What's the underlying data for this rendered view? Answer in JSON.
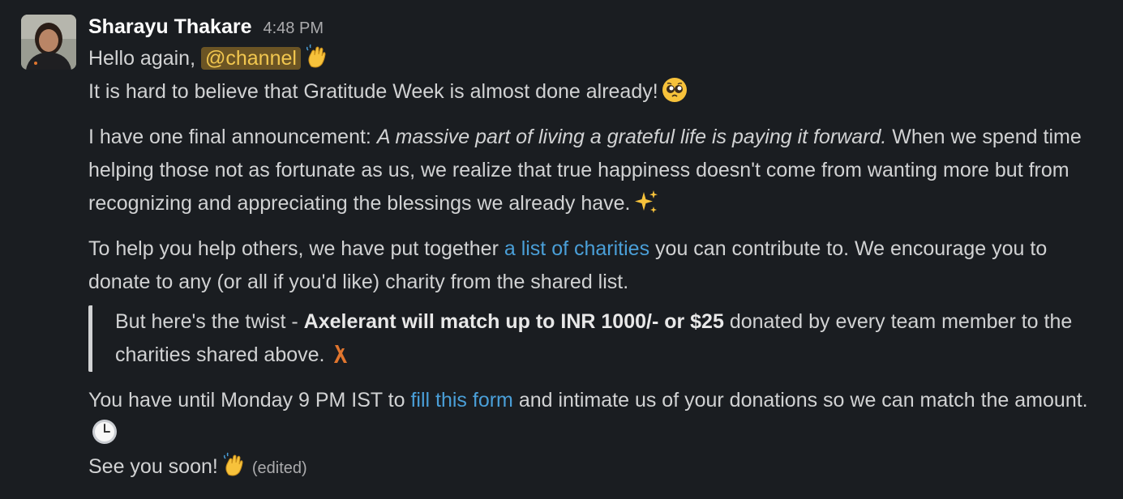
{
  "message": {
    "sender": "Sharayu Thakare",
    "timestamp": "4:48 PM",
    "line1_prefix": "Hello again, ",
    "mention": "@channel",
    "line2": "It is hard to believe that Gratitude Week is almost done already!",
    "para2_prefix": "I have one final announcement: ",
    "para2_italic": "A massive part of living a grateful life is paying it forward.",
    "para2_rest": " When we spend time helping those not as fortunate as us, we realize that true happiness doesn't come from wanting more but from recognizing and appreciating the blessings we already have.",
    "para3_prefix": "To help you help others, we have put together ",
    "para3_link": "a list of charities",
    "para3_rest": " you can contribute to. We encourage you to donate to any (or all if you'd like) charity from the shared list.",
    "quote_prefix": "But here's the twist - ",
    "quote_bold": "Axelerant will match up to INR 1000/- or $25",
    "quote_rest": " donated by every team member to the charities shared above.",
    "para5_prefix": "You have until Monday 9 PM IST to ",
    "para5_link": "fill this form",
    "para5_rest": " and intimate us of your donations so we can match the amount.",
    "closing": "See you soon!",
    "edited": "(edited)"
  },
  "icons": {
    "wave": "waving-hand-icon",
    "pleading": "pleading-face-icon",
    "sparkles": "sparkles-icon",
    "axelerant": "axelerant-logo-icon",
    "clock": "clock-icon"
  },
  "colors": {
    "background": "#1a1d21",
    "text": "#d1d2d3",
    "link": "#4a9fd8",
    "mention_bg": "#6b5424",
    "mention_text": "#f2c74f"
  }
}
